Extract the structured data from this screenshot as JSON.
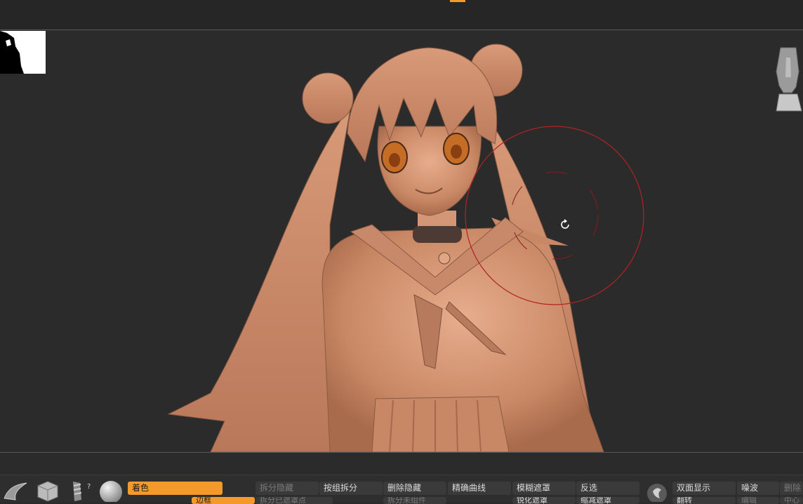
{
  "toolbar": {
    "row1": [
      {
        "label": "着色",
        "state": "active"
      },
      {
        "label": "拆分隐藏",
        "state": "disabled"
      },
      {
        "label": "按组拆分",
        "state": "normal"
      },
      {
        "label": "删除隐藏",
        "state": "normal"
      },
      {
        "label": "精确曲线",
        "state": "normal"
      },
      {
        "label": "模糊遮罩",
        "state": "normal"
      },
      {
        "label": "反选",
        "state": "normal"
      },
      {
        "label": "双面显示",
        "state": "normal"
      },
      {
        "label": "噪波",
        "state": "normal"
      },
      {
        "label": "删除",
        "state": "disabled"
      }
    ],
    "row2": [
      {
        "label": "边框",
        "state": "active"
      },
      {
        "label": "拆分已遮罩点",
        "state": "disabled"
      },
      {
        "label": "拆分未组件",
        "state": "disabled"
      },
      {
        "label": "锐化遮罩",
        "state": "normal"
      },
      {
        "label": "缩减遮罩",
        "state": "normal"
      },
      {
        "label": "翻转",
        "state": "normal"
      },
      {
        "label": "编辑",
        "state": "disabled"
      },
      {
        "label": "中心",
        "state": "disabled"
      }
    ],
    "help_mark": "?"
  },
  "icons": {
    "brush": "brush-preview-icon",
    "texture": "texture-icon",
    "alpha": "alpha-stroke-icon",
    "material": "material-sphere-icon",
    "matcap": "matcap-icon",
    "navigation": "navigation-head-icon",
    "rotate_cursor": "rotate-cursor-icon"
  },
  "colors": {
    "accent": "#f39a2b",
    "cursor_ring": "#b22222",
    "model_skin": "#d39676",
    "viewport_bg": "#2b2b2b"
  }
}
